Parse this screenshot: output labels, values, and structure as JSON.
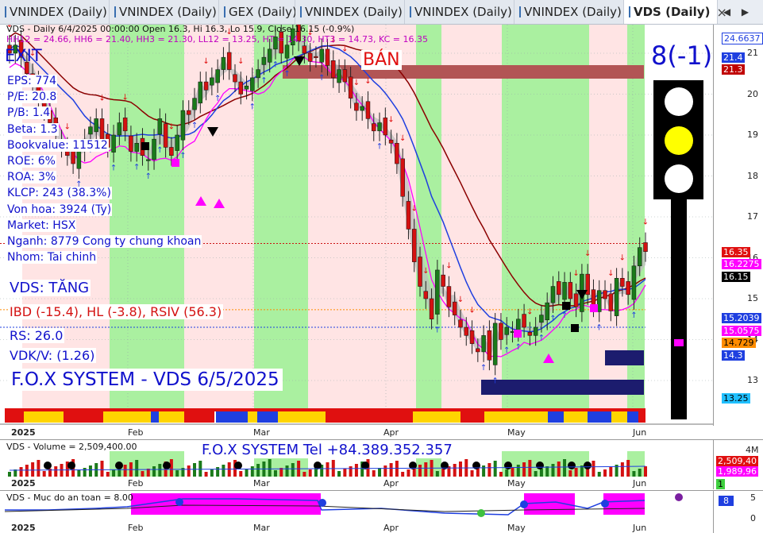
{
  "tabs": [
    {
      "label": "VNINDEX (Daily)",
      "active": false
    },
    {
      "label": "VNINDEX (Daily)",
      "active": false
    },
    {
      "label": "GEX (Daily)",
      "active": false
    },
    {
      "label": "VNINDEX (Daily)",
      "active": false
    },
    {
      "label": "VNINDEX (Daily)",
      "active": false
    },
    {
      "label": "VNINDEX (Daily)",
      "active": false
    },
    {
      "label": "VDS (Daily)",
      "active": true
    }
  ],
  "tab_close": "×",
  "tab_nav": [
    "◀",
    "▶"
  ],
  "header": {
    "line1": "VDS - Daily 6/4/2025 00:00:00 Open 16.3, Hi 16.3, Lo 15.9, Close 16.15 (-0.9%)",
    "line2": "HH12 = 24.66, HH6 = 21.40, HH3 = 21.30, LL12 = 13.25, HT = 14.30, HT3 = 14.73, KC = 16.35"
  },
  "overlay": {
    "exit": "EXIT",
    "ban": "BÁN",
    "score": "8(-1)",
    "info": [
      "EPS: 774",
      "P/E: 20.8",
      "P/B: 1.4",
      "Beta: 1.3",
      "Bookvalue: 11512",
      "ROE: 6%",
      "ROA: 3%",
      "KLCP: 243 (38.3%)",
      "Von hoa: 3924 (Ty)",
      "Market: HSX",
      "Nganh: 8779 Cong ty chung khoan",
      "Nhom: Tai chinh"
    ],
    "status": "VDS: TĂNG",
    "ibd": "IBD (-15.4), HL (-3.8), RSIV (56.3)",
    "rs": "RS: 26.0",
    "vdk": "VDK/V:  (1.26)",
    "system": "F.O.X SYSTEM - VDS 6/5/2025",
    "tel": "F.O.X SYSTEM Tel +84.389.352.357"
  },
  "colors": {
    "up": "#1a7a1a",
    "down": "#d41111",
    "bg_green": "#aaf0a0",
    "bg_pink": "#ffe4e4",
    "blue_line": "#1f3fe0",
    "red_line": "#8b0000",
    "magenta": "#ff00ff",
    "cyan": "#5fe6f0",
    "navy": "#1c1c6e"
  },
  "chart_data": {
    "type": "candlestick",
    "symbol": "VDS",
    "interval": "Daily",
    "month_labels": [
      "2025",
      "Feb",
      "Mar",
      "Apr",
      "May",
      "Jun"
    ],
    "y_ticks": [
      13,
      14,
      15,
      16,
      17,
      18,
      19,
      20,
      21
    ],
    "ylim": [
      12.55,
      24.95
    ],
    "price_tags": [
      {
        "label": "24.6637",
        "value": 24.6637,
        "color": "#ffffff",
        "bg": "#1f3fe0",
        "textcolor": "#ffffff"
      },
      {
        "label": "21.4",
        "value": 21.4,
        "bg": "#1f3fe0",
        "textcolor": "#ffffff"
      },
      {
        "label": "21.3",
        "value": 21.3,
        "bg": "#c00000",
        "textcolor": "#ffffff"
      },
      {
        "label": "16.35",
        "value": 16.35,
        "bg": "#e01010",
        "textcolor": "#ffffff"
      },
      {
        "label": "16.2275",
        "value": 16.2275,
        "bg": "#ff00ff",
        "textcolor": "#ffffff"
      },
      {
        "label": "16.15",
        "value": 16.15,
        "bg": "#000000",
        "textcolor": "#ffffff"
      },
      {
        "label": "15.2039",
        "value": 15.2039,
        "bg": "#1f3fe0",
        "textcolor": "#ffffff"
      },
      {
        "label": "15.0575",
        "value": 15.0575,
        "bg": "#ff00ff",
        "textcolor": "#ffffff"
      },
      {
        "label": "14.729",
        "value": 14.729,
        "bg": "#ff8c00",
        "textcolor": "#000000"
      },
      {
        "label": "14.3",
        "value": 14.3,
        "bg": "#1f3fe0",
        "textcolor": "#ffffff"
      },
      {
        "label": "13.25",
        "value": 13.25,
        "bg": "#20c0ff",
        "textcolor": "#000000"
      }
    ],
    "closes": [
      21.0,
      21.2,
      20.9,
      20.5,
      20.2,
      19.9,
      19.6,
      19.3,
      19.0,
      18.7,
      18.5,
      18.3,
      18.6,
      18.9,
      19.2,
      19.4,
      18.9,
      18.7,
      19.0,
      19.3,
      19.1,
      18.6,
      18.8,
      18.5,
      18.4,
      18.9,
      19.4,
      18.7,
      18.5,
      19.0,
      19.6,
      19.5,
      19.9,
      20.3,
      20.1,
      20.4,
      20.6,
      20.9,
      20.6,
      20.3,
      20.0,
      20.2,
      20.4,
      20.6,
      20.9,
      21.1,
      21.4,
      21.0,
      21.2,
      21.6,
      21.3,
      21.0,
      20.8,
      20.9,
      21.1,
      20.7,
      20.4,
      20.6,
      20.3,
      19.9,
      19.6,
      19.7,
      19.4,
      19.1,
      19.3,
      19.0,
      18.8,
      18.3,
      17.5,
      16.7,
      15.9,
      15.3,
      15.0,
      14.5,
      15.7,
      15.3,
      14.8,
      14.6,
      14.3,
      14.1,
      13.9,
      13.7,
      14.1,
      13.5,
      14.4,
      14.0,
      14.3,
      14.2,
      14.5,
      14.3,
      14.1,
      14.3,
      14.6,
      14.9,
      15.3,
      15.1,
      15.4,
      15.0,
      14.8,
      15.6,
      15.1,
      14.8,
      15.2,
      15.0,
      14.7,
      15.5,
      15.3,
      15.1,
      15.8,
      16.25,
      16.15
    ],
    "volume": {
      "label": "VDS - Volume = 2,509,400.00",
      "last": 2509400,
      "tags": [
        "2,509,40",
        "1,989,96",
        "1"
      ],
      "y_ticks": [
        "4M"
      ]
    },
    "safety": {
      "label": "VDS - Muc do an toan = 8.00",
      "value": 8.0,
      "tag": "8",
      "y_ticks": [
        0,
        5
      ]
    }
  }
}
